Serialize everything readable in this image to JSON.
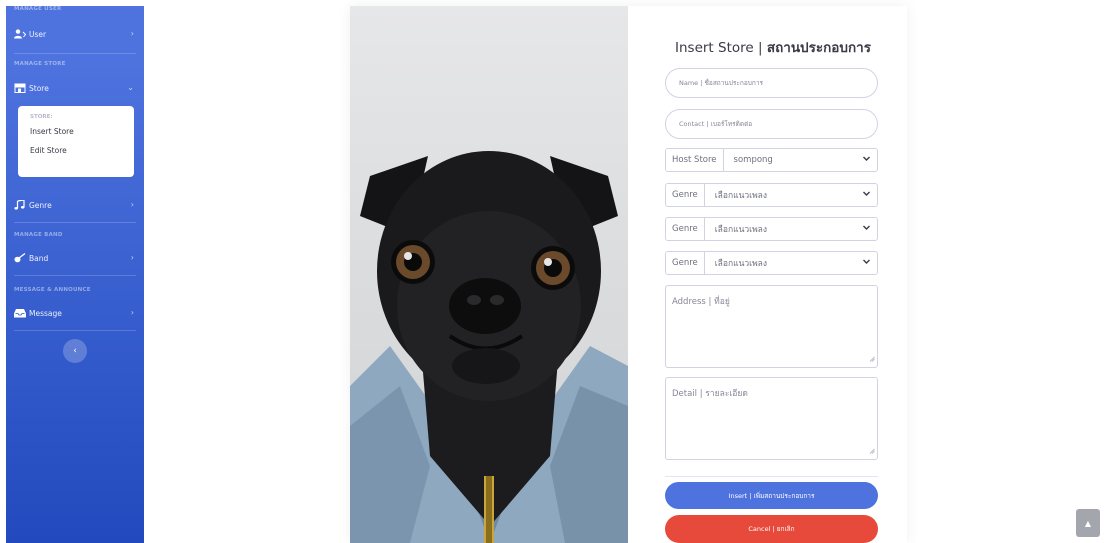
{
  "sidebar": {
    "headings": {
      "manage_user": "MANAGE USER",
      "manage_store": "MANAGE STORE",
      "manage_band": "MANAGE BAND",
      "message_announce": "MESSAGE & ANNOUNCE"
    },
    "items": {
      "user": "User",
      "store": "Store",
      "genre": "Genre",
      "band": "Band",
      "message": "Message"
    },
    "store_submenu": {
      "header": "STORE:",
      "insert": "Insert Store",
      "edit": "Edit Store"
    },
    "toggle_icon": "chevron-left-icon"
  },
  "form": {
    "title_en": "Insert Store | ",
    "title_th": "สถานประกอบการ",
    "name_placeholder": "Name | ชื่อสถานประกอบการ",
    "contact_placeholder": "Contact | เบอร์โทรติดต่อ",
    "host_label": "Host Store",
    "host_value": "sompong",
    "genre_label": "Genre",
    "genre_select_1": "เลือกแนวเพลง",
    "genre_select_2": "เลือกแนวเพลง",
    "genre_select_3": "เลือกแนวเพลง",
    "address_placeholder": "Address | ที่อยู่",
    "detail_placeholder": "Detail | รายละเอียด",
    "insert_button": "Insert | เพิ่มสถานประกอบการ",
    "cancel_button": "Cancel | ยกเลิก"
  },
  "colors": {
    "primary": "#4e73df",
    "primary_dark": "#224abe",
    "danger": "#e74a3b",
    "text": "#3a3b45",
    "muted": "#858796"
  },
  "photo_subject": "pug in denim jacket"
}
